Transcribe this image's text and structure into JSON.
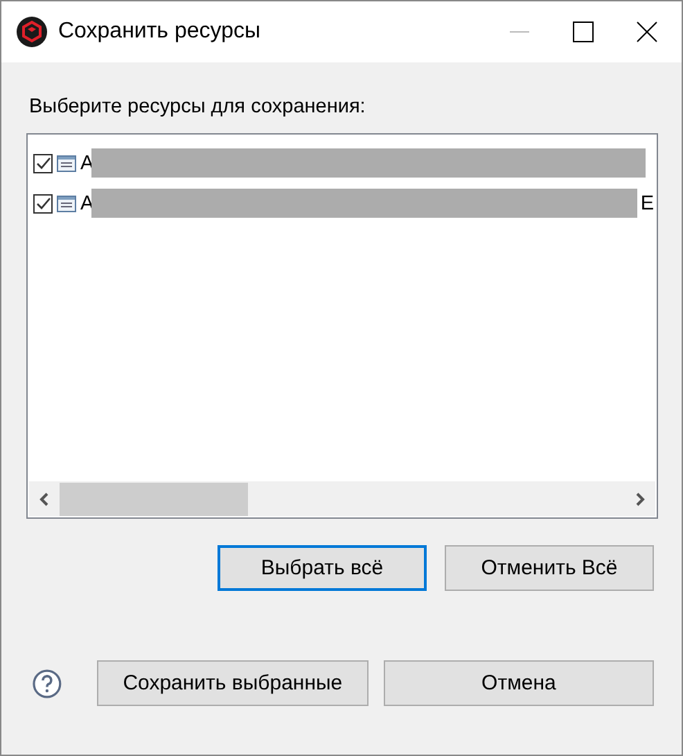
{
  "window": {
    "title": "Сохранить ресурсы"
  },
  "prompt": "Выберите ресурсы для сохранения:",
  "resources": [
    {
      "label": "A",
      "checked": true
    },
    {
      "label": "A",
      "tail": "E",
      "checked": true
    }
  ],
  "select_buttons": [
    {
      "label": "Выбрать всё",
      "focused": true
    },
    {
      "label": "Отменить Всё",
      "focused": false
    }
  ],
  "dialog_buttons": [
    {
      "label": "Сохранить выбранные"
    },
    {
      "label": "Отмена"
    }
  ]
}
